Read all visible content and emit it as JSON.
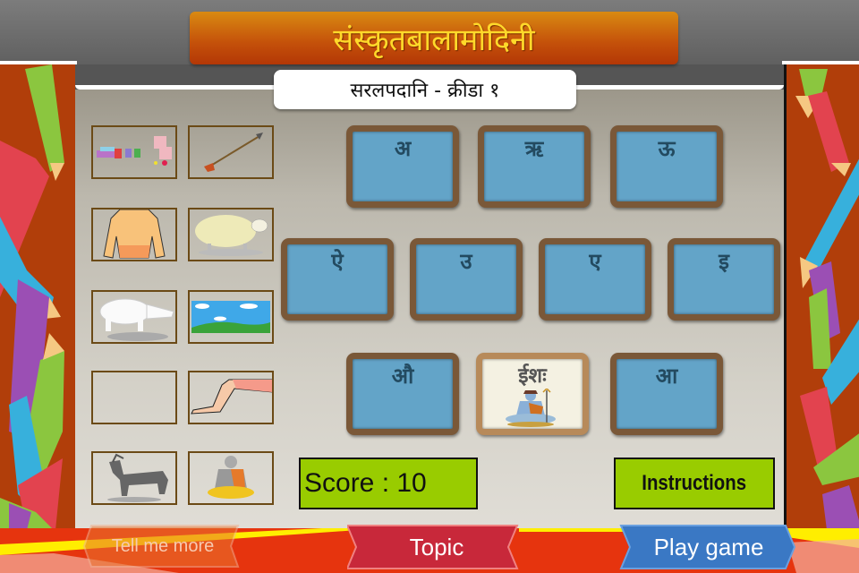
{
  "header": {
    "app_title": "संस्कृतबालामोदिनी",
    "subtitle": "सरलपदानि - क्रीडा १"
  },
  "pictures": [
    {
      "name": "medicines",
      "icon": "medicine-bottles-icon"
    },
    {
      "name": "arrow",
      "icon": "arrow-icon"
    },
    {
      "name": "torso",
      "icon": "human-torso-icon"
    },
    {
      "name": "sheep",
      "icon": "sheep-icon"
    },
    {
      "name": "elephant",
      "icon": "white-elephant-icon"
    },
    {
      "name": "sky",
      "icon": "sky-landscape-icon"
    },
    {
      "name": "empty",
      "icon": "empty-slot"
    },
    {
      "name": "leg",
      "icon": "leg-icon"
    },
    {
      "name": "goat",
      "icon": "goat-icon"
    },
    {
      "name": "sage",
      "icon": "sage-icon"
    }
  ],
  "cards": [
    {
      "letter": "अ",
      "revealed": false
    },
    {
      "letter": "ऋ",
      "revealed": false
    },
    {
      "letter": "ऊ",
      "revealed": false
    },
    {
      "letter": "ऐ",
      "revealed": false
    },
    {
      "letter": "उ",
      "revealed": false
    },
    {
      "letter": "ए",
      "revealed": false
    },
    {
      "letter": "इ",
      "revealed": false
    },
    {
      "letter": "औ",
      "revealed": false
    },
    {
      "letter": "ईशः",
      "revealed": true,
      "image": "shiva-icon"
    },
    {
      "letter": "आ",
      "revealed": false
    }
  ],
  "score": {
    "label": "Score : 10",
    "value": 10
  },
  "buttons": {
    "instructions": "Instructions",
    "tell_me_more": "Tell me more",
    "topic": "Topic",
    "play_game": "Play game"
  },
  "colors": {
    "score_bg": "#99cc00",
    "card_blue": "#63a4c8",
    "title_yellow": "#ffd92a",
    "side_bg": "#b13e0a",
    "bottom_red": "#e6340e",
    "topic_red": "#c8283a",
    "play_blue": "#3a78c4"
  }
}
